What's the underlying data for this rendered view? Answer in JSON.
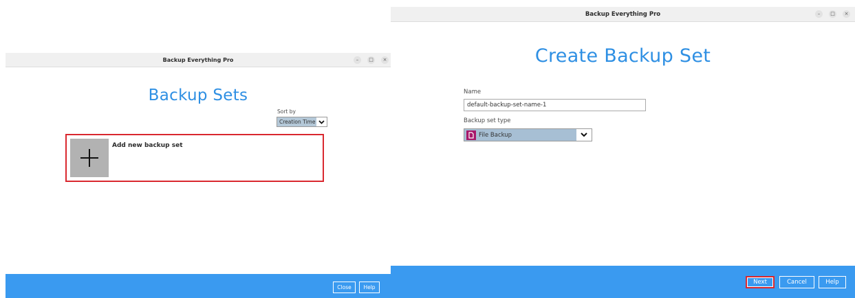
{
  "left_window": {
    "title": "Backup Everything Pro",
    "controls": {
      "minimize": "–",
      "maximize": "□",
      "close": "×"
    },
    "heading": "Backup Sets",
    "sort_label": "Sort by",
    "sort_value": "Creation Time",
    "add_label": "Add new backup set",
    "footer_buttons": {
      "close": "Close",
      "help": "Help"
    }
  },
  "right_window": {
    "title": "Backup Everything Pro",
    "controls": {
      "minimize": "–",
      "maximize": "□",
      "close": "×"
    },
    "heading": "Create Backup Set",
    "name_label": "Name",
    "name_value": "default-backup-set-name-1",
    "type_label": "Backup set type",
    "type_value": "File Backup",
    "footer_buttons": {
      "next": "Next",
      "cancel": "Cancel",
      "help": "Help"
    }
  },
  "colors": {
    "accent_blue": "#3a9af0",
    "heading_blue": "#2e8fe3",
    "highlight_red": "#d9272e",
    "file_icon_magenta": "#a8176a"
  }
}
